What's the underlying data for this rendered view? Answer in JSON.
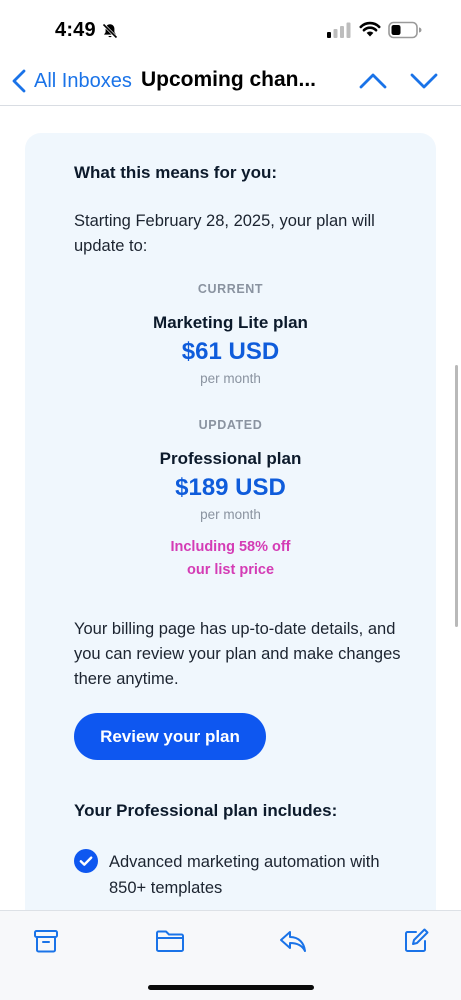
{
  "status_bar": {
    "time": "4:49"
  },
  "nav": {
    "back_label": "All Inboxes",
    "title": "Upcoming chan..."
  },
  "email": {
    "heading": "What this means for you:",
    "intro": "Starting February 28, 2025, your plan will update to:",
    "current": {
      "tag": "CURRENT",
      "plan_name": "Marketing Lite plan",
      "price": "$61 USD",
      "period": "per month"
    },
    "updated": {
      "tag": "UPDATED",
      "plan_name": "Professional plan",
      "price": "$189 USD",
      "period": "per month",
      "discount_line1": "Including 58% off",
      "discount_line2": "our list price"
    },
    "billing_text": "Your billing page has up-to-date details, and you can review your plan and make changes there anytime.",
    "cta_label": "Review your plan",
    "includes_heading": "Your Professional plan includes:",
    "features": [
      "Advanced marketing automation with 850+ templates"
    ]
  },
  "colors": {
    "link_blue": "#1a73e8",
    "price_blue": "#0f5cdb",
    "button_blue": "#0e57f0",
    "discount_pink": "#d43cb5",
    "card_bg": "#f0f7fd"
  },
  "toolbar": {
    "icons": [
      "archive-icon",
      "folder-icon",
      "reply-icon",
      "compose-icon"
    ]
  }
}
